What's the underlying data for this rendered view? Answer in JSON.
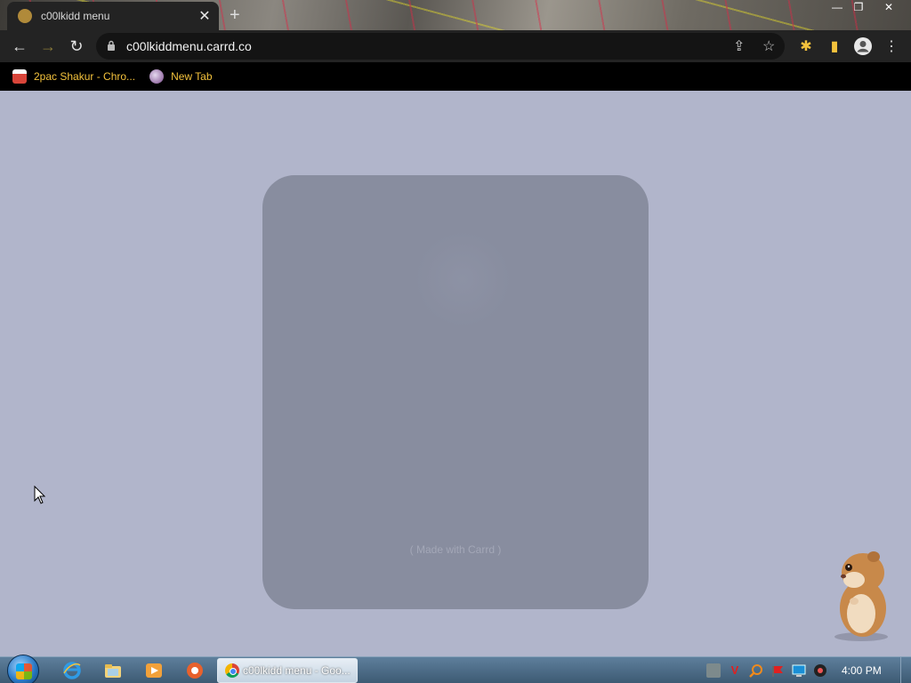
{
  "browser": {
    "tab": {
      "title": "c00lkidd menu",
      "close_glyph": "✕"
    },
    "new_tab_glyph": "+",
    "window_controls": {
      "minimize": "—",
      "maximize": "❐",
      "close": "✕"
    },
    "toolbar": {
      "back": "←",
      "forward": "→",
      "reload": "↻",
      "url": "c00lkiddmenu.carrd.co",
      "share": "⇪",
      "bookmark": "☆",
      "extensions": "✱",
      "sidepanel": "▮",
      "profile": "●",
      "menu": "⋮"
    },
    "bookmarks": [
      {
        "label": "2pac Shakur - Chro...",
        "icon": "bookmark-app-icon"
      },
      {
        "label": "New Tab",
        "icon": "new-tab-favicon"
      }
    ]
  },
  "page": {
    "background": "#b1b5cb",
    "card_color": "#888d9f",
    "footer_text": "( Made with Carrd )"
  },
  "taskbar": {
    "task_label": "c00lkidd menu - Goo...",
    "pinned": [
      "ie-icon",
      "explorer-icon",
      "media-player-icon",
      "app-icon"
    ],
    "tray": [
      "tray-icon-1",
      "tray-icon-2",
      "tray-icon-3",
      "tray-icon-4",
      "tray-icon-5",
      "tray-icon-6"
    ],
    "clock": "4:00 PM"
  }
}
